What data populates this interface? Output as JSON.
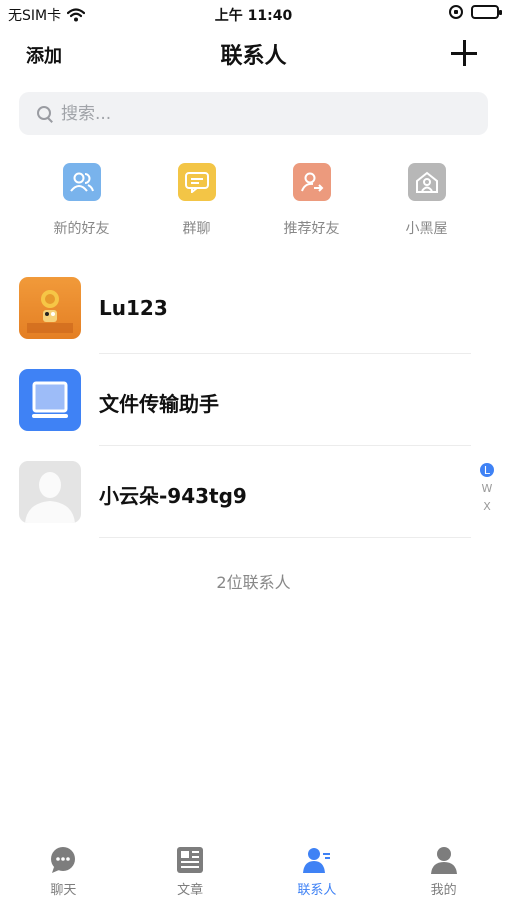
{
  "status_bar": {
    "carrier": "无SIM卡",
    "time": "上午 11:40"
  },
  "nav": {
    "left_action": "添加",
    "title": "联系人"
  },
  "search": {
    "placeholder": "搜索..."
  },
  "quick_actions": [
    {
      "label": "新的好友",
      "icon": "users-icon",
      "color": "#79b3ec"
    },
    {
      "label": "群聊",
      "icon": "chat-bubble-icon",
      "color": "#f3c546"
    },
    {
      "label": "推荐好友",
      "icon": "user-share-icon",
      "color": "#ec9a7d"
    },
    {
      "label": "小黑屋",
      "icon": "house-lock-icon",
      "color": "#b7b7b7"
    }
  ],
  "contacts": [
    {
      "name": "Lu123",
      "avatar": "orange-cartoon-avatar"
    },
    {
      "name": "文件传输助手",
      "avatar": "file-transfer-icon"
    },
    {
      "name": "小云朵-943tg9",
      "avatar": "default-person-avatar"
    }
  ],
  "contacts_count": "2位联系人",
  "index_bar": {
    "letters": [
      "L",
      "W",
      "X"
    ],
    "active": "L"
  },
  "tabs": [
    {
      "label": "聊天",
      "icon": "chat-icon",
      "active": false
    },
    {
      "label": "文章",
      "icon": "article-icon",
      "active": false
    },
    {
      "label": "联系人",
      "icon": "contacts-icon",
      "active": true
    },
    {
      "label": "我的",
      "icon": "profile-icon",
      "active": false
    }
  ],
  "colors": {
    "accent": "#3f82f5",
    "inactive_tab": "#7d7d7d",
    "battery": "#31c451"
  }
}
